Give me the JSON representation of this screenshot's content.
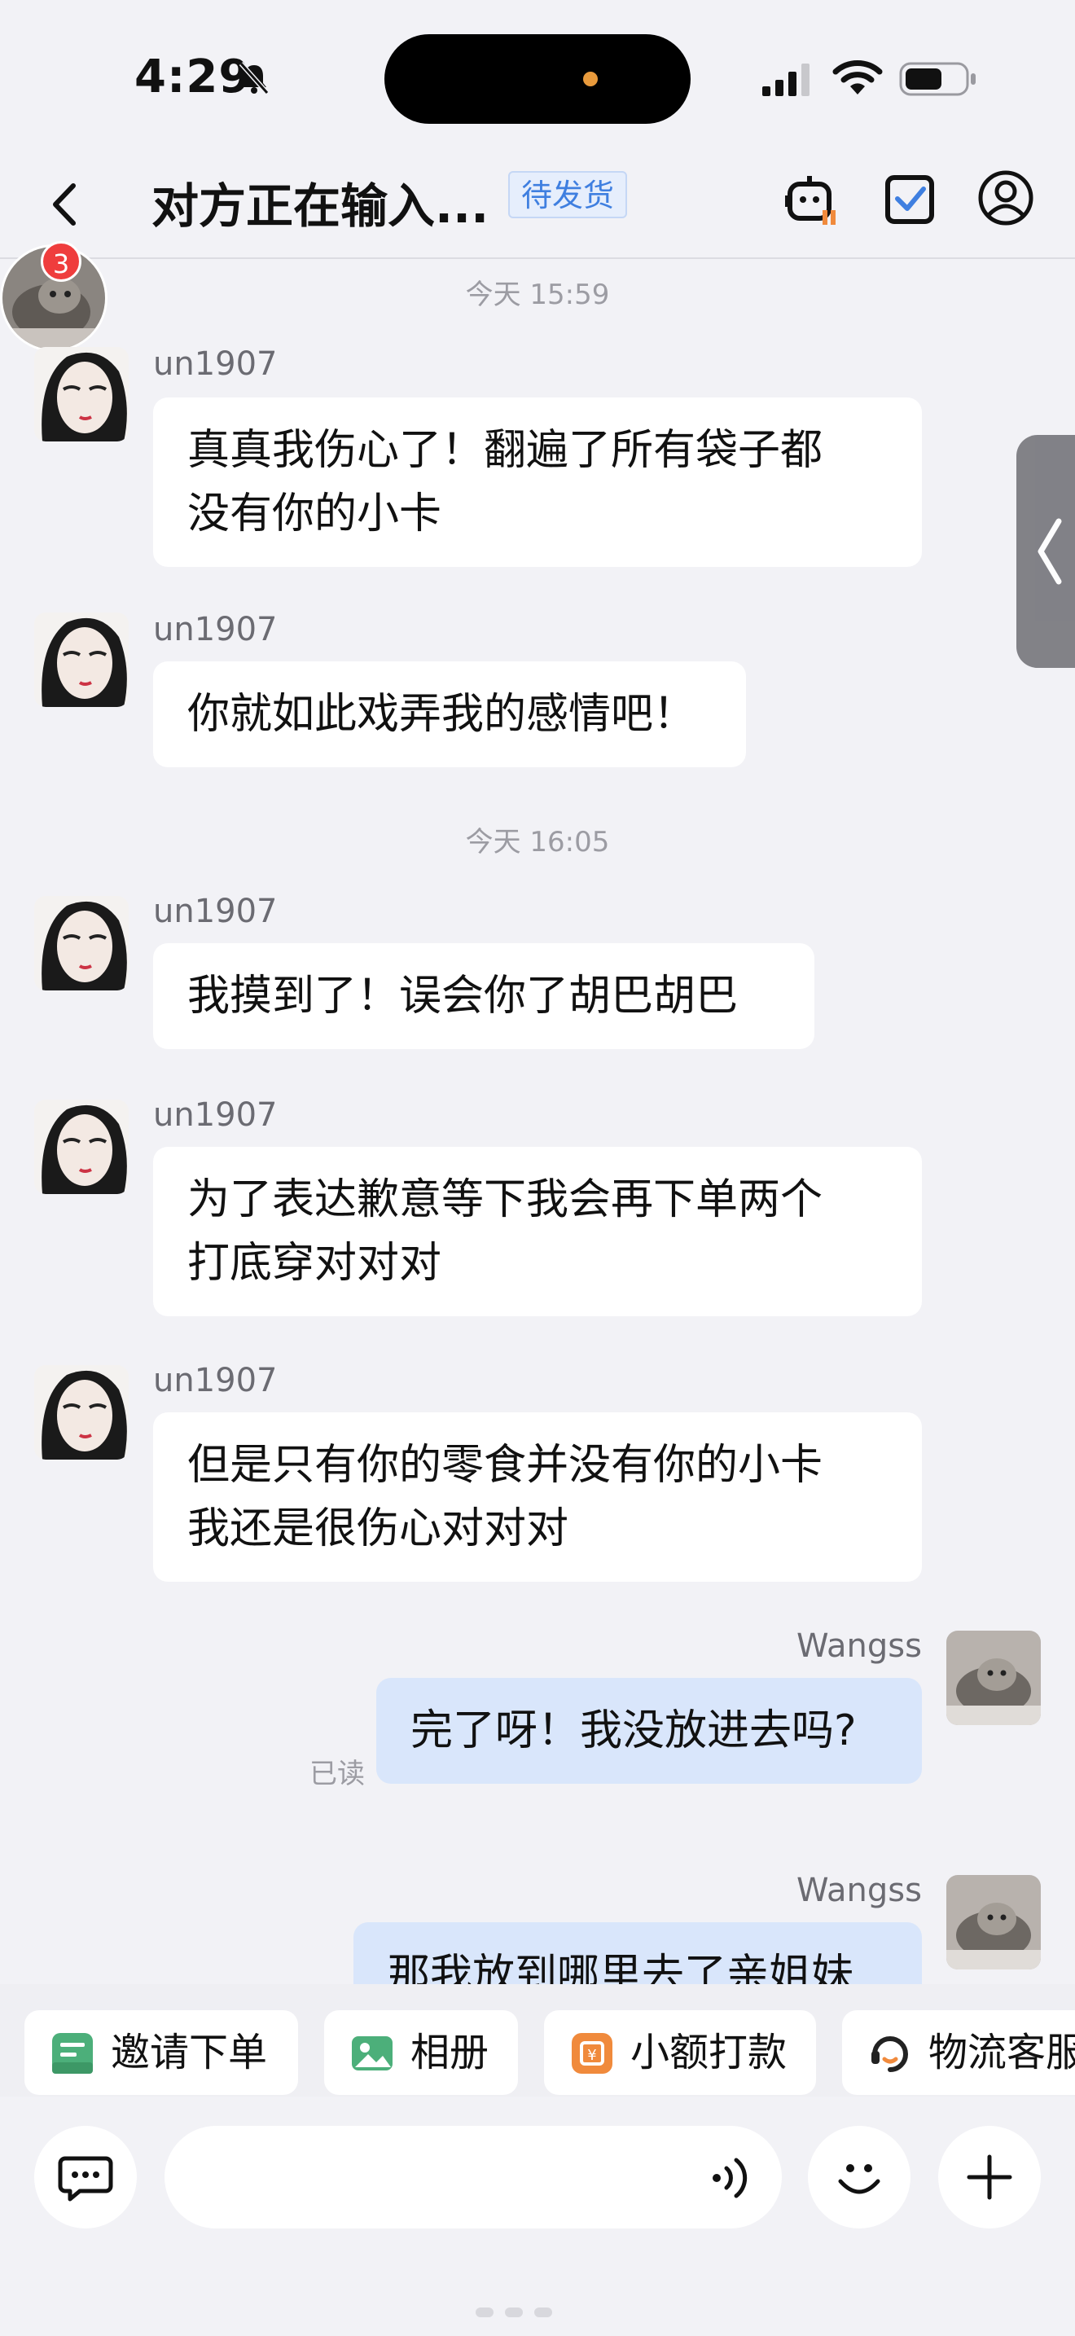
{
  "status_bar": {
    "time": "4:29"
  },
  "header": {
    "title": "对方正在输入...",
    "order_status": "待发货"
  },
  "notification_count": "3",
  "messages": [
    {
      "type": "time",
      "text": "今天 15:59"
    },
    {
      "type": "msg",
      "sender": "un1907",
      "lines": [
        "真真我伤心了！翻遍了所有袋子都",
        "没有你的小卡"
      ]
    },
    {
      "type": "msg",
      "sender": "un1907",
      "lines": [
        "你就如此戏弄我的感情吧！"
      ]
    },
    {
      "type": "time",
      "text": "今天 16:05"
    },
    {
      "type": "msg",
      "sender": "un1907",
      "lines": [
        "我摸到了！误会你了胡巴胡巴"
      ]
    },
    {
      "type": "msg",
      "sender": "un1907",
      "lines": [
        "为了表达歉意等下我会再下单两个",
        "打底穿对对对"
      ]
    },
    {
      "type": "msg",
      "sender": "un1907",
      "lines": [
        "但是只有你的零食并没有你的小卡",
        "我还是很伤心对对对"
      ]
    },
    {
      "type": "msg",
      "sender": "Wangss",
      "lines": [
        "完了呀！我没放进去吗?"
      ],
      "status": "已读"
    },
    {
      "type": "msg",
      "sender": "Wangss",
      "lines": [
        "那我放到哪里去了亲姐妹"
      ]
    }
  ],
  "quick_actions": [
    {
      "label": "邀请下单",
      "icon": "invite-order-icon",
      "color": "#4caf7a"
    },
    {
      "label": "相册",
      "icon": "album-icon",
      "color": "#4caf7a"
    },
    {
      "label": "小额打款",
      "icon": "payment-icon",
      "color": "#f08a3c"
    },
    {
      "label": "物流客服",
      "icon": "logistics-service-icon",
      "color": "#222222"
    }
  ],
  "input": {
    "placeholder": ""
  },
  "colors": {
    "accent": "#3f7fe0",
    "bubble_mine": "#d9e6fb",
    "badge": "#ef3d3d"
  }
}
